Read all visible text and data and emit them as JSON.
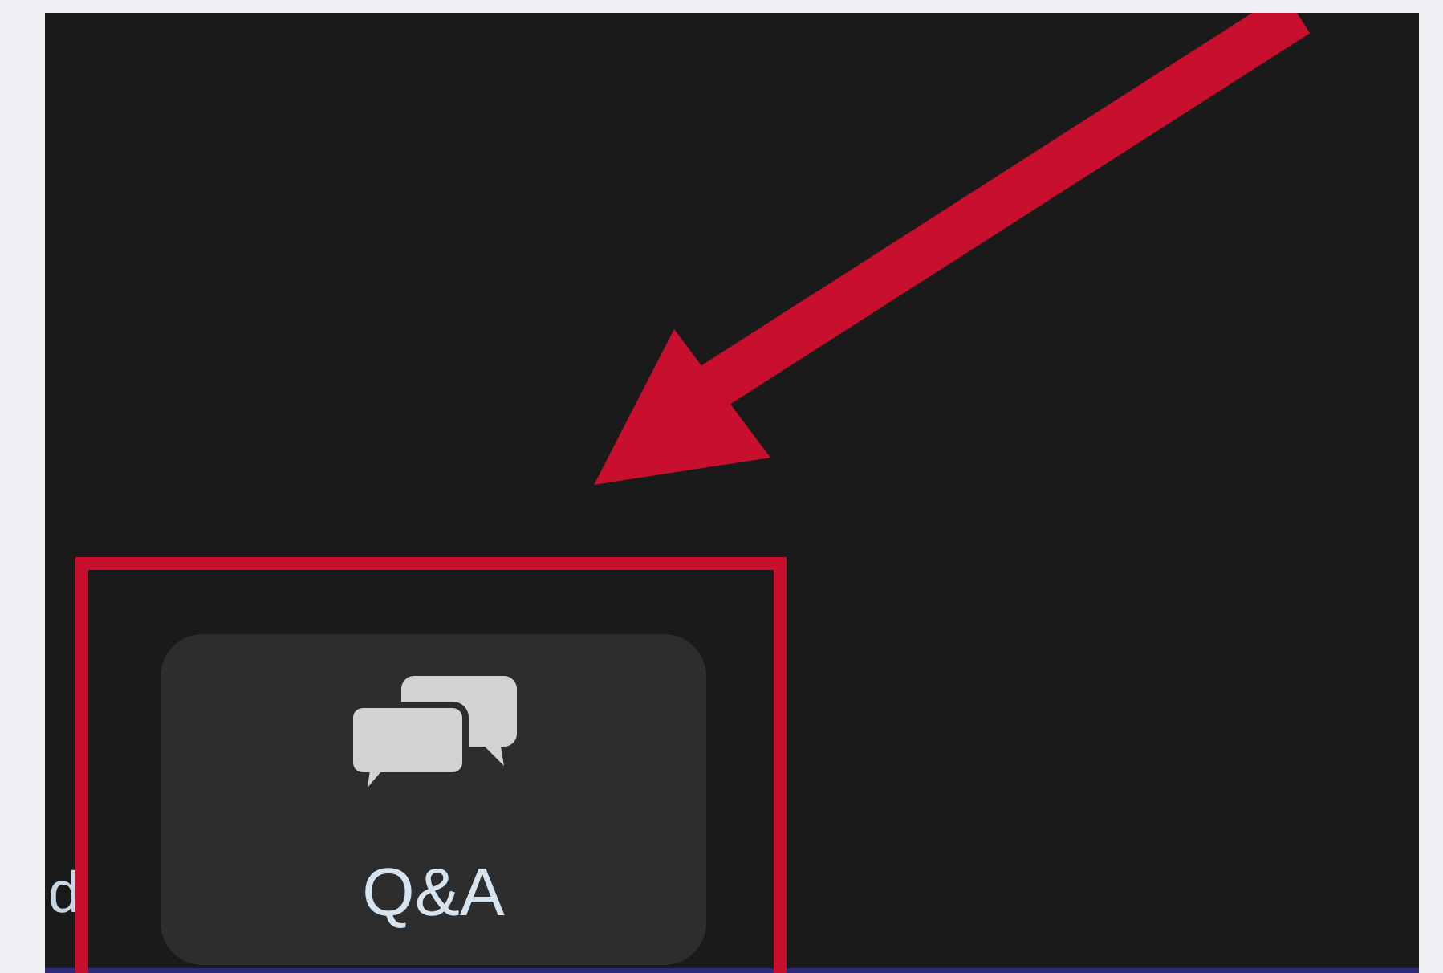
{
  "toolbar": {
    "items": [
      {
        "kind": "cut",
        "label": "d"
      },
      {
        "kind": "button",
        "label": "Q&A"
      }
    ]
  }
}
